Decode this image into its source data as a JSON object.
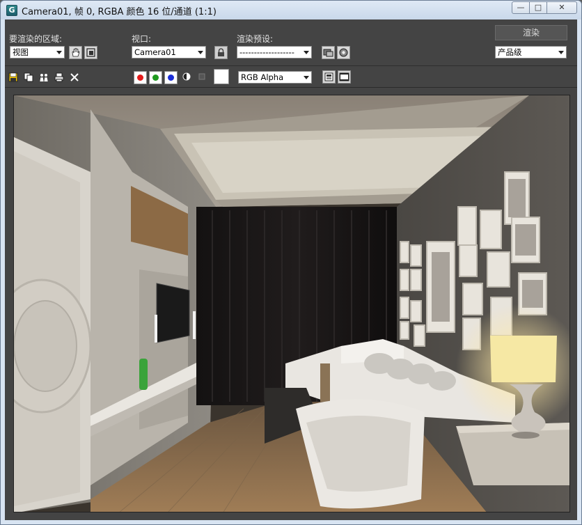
{
  "window": {
    "title": "Camera01, 帧 0, RGBA 颜色 16 位/通道 (1:1)",
    "app_icon_letter": "G",
    "buttons": {
      "minimize": "—",
      "maximize": "□",
      "close": "✕"
    }
  },
  "toolbar": {
    "area_label": "要渲染的区域:",
    "area_value": "视图",
    "viewport_label": "视口:",
    "viewport_value": "Camera01",
    "preset_label": "渲染预设:",
    "preset_value": "-------------------",
    "render_button": "渲染",
    "quality_value": "产品级",
    "channel_value": "RGB Alpha"
  },
  "icons": {
    "area_hand": "hand-icon",
    "area_crop": "crop-region-icon",
    "lock": "lock-icon",
    "preset_env": "environment-icon",
    "preset_settings": "render-setup-icon",
    "save": "save-icon",
    "copy": "copy-icon",
    "clone": "clone-window-icon",
    "print": "print-icon",
    "clear": "clear-icon",
    "red": "red-channel-icon",
    "green": "green-channel-icon",
    "blue": "blue-channel-icon",
    "alpha": "alpha-channel-icon",
    "mono": "monochrome-icon",
    "swatch": "color-swatch",
    "toggle_ui": "toggle-ui-overlay-icon",
    "toggle_ui2": "toggle-ui-icon"
  },
  "colors": {
    "red": "#e41b1b",
    "green": "#1f9a1f",
    "blue": "#1b2ed8",
    "panel": "#444444"
  }
}
